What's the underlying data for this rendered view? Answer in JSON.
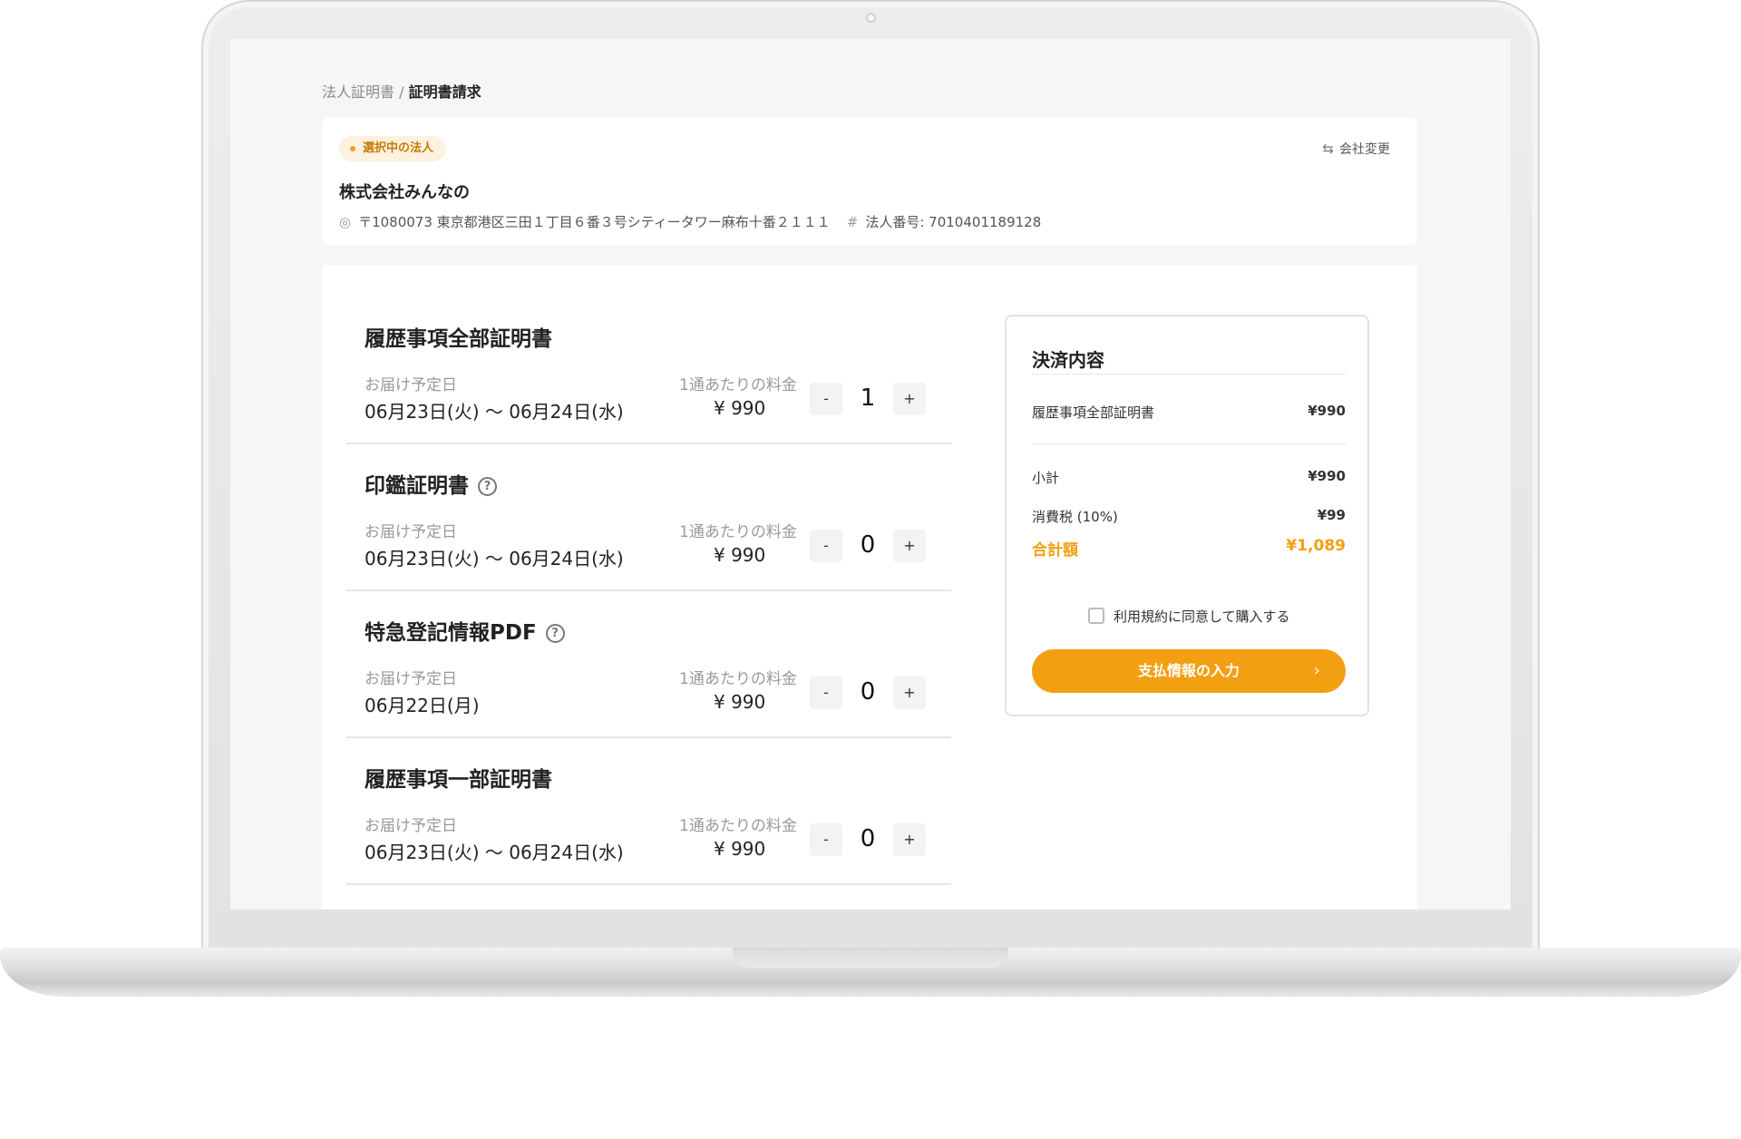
{
  "breadcrumb": {
    "parent": "法人証明書",
    "separator": " / ",
    "current": "証明書請求"
  },
  "company": {
    "badge": "選択中の法人",
    "change_label": "会社変更",
    "name": "株式会社みんなの",
    "address": "〒1080073 東京都港区三田１丁目６番３号シティータワー麻布十番２１１１",
    "corp_number": "法人番号: 7010401189128"
  },
  "items": [
    {
      "title": "履歴事項全部証明書",
      "has_help": false,
      "date_label": "お届け予定日",
      "date": "06月23日(火) 〜 06月24日(水)",
      "price_label": "1通あたりの料金",
      "price": "¥ 990",
      "qty": "1",
      "minus": "-",
      "plus": "+"
    },
    {
      "title": "印鑑証明書",
      "has_help": true,
      "date_label": "お届け予定日",
      "date": "06月23日(火) 〜 06月24日(水)",
      "price_label": "1通あたりの料金",
      "price": "¥ 990",
      "qty": "0",
      "minus": "-",
      "plus": "+"
    },
    {
      "title": "特急登記情報PDF",
      "has_help": true,
      "date_label": "お届け予定日",
      "date": "06月22日(月)",
      "price_label": "1通あたりの料金",
      "price": "¥ 990",
      "qty": "0",
      "minus": "-",
      "plus": "+"
    },
    {
      "title": "履歴事項一部証明書",
      "has_help": false,
      "date_label": "お届け予定日",
      "date": "06月23日(火) 〜 06月24日(水)",
      "price_label": "1通あたりの料金",
      "price": "¥ 990",
      "qty": "0",
      "minus": "-",
      "plus": "+"
    }
  ],
  "summary": {
    "title": "決済内容",
    "line_item": {
      "label": "履歴事項全部証明書",
      "amount": "¥990"
    },
    "subtotal": {
      "label": "小計",
      "amount": "¥990"
    },
    "tax": {
      "label": "消費税 (10%)",
      "amount": "¥99"
    },
    "total": {
      "label": "合計額",
      "amount": "¥1,089"
    },
    "terms": "利用規約に同意して購入する",
    "pay_button": "支払情報の入力"
  },
  "icons": {
    "location": "location-pin-icon",
    "hash": "hash-icon",
    "swap": "swap-icon",
    "help": "help-circle-icon",
    "chevron": "chevron-right-icon"
  },
  "colors": {
    "accent": "#f39f12",
    "badge_bg": "#fdf1df",
    "screen_bg": "#f6f6f7"
  }
}
